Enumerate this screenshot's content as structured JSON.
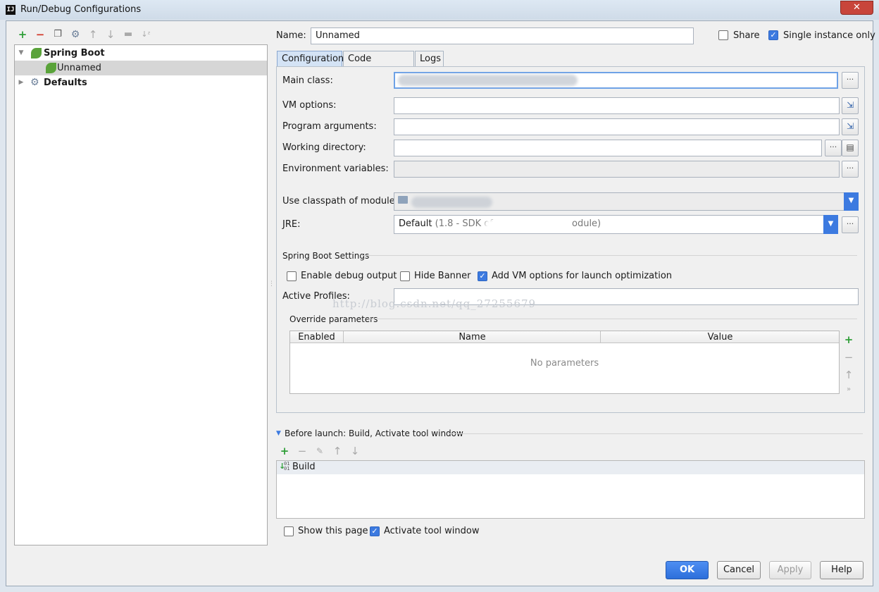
{
  "window": {
    "title": "Run/Debug Configurations",
    "app_icon_text": "IJ"
  },
  "tree": {
    "items": [
      {
        "label": "Spring Boot",
        "bold": true
      },
      {
        "label": "Unnamed",
        "bold": false
      },
      {
        "label": "Defaults",
        "bold": true
      }
    ]
  },
  "form": {
    "name_label": "Name:",
    "name_value": "Unnamed",
    "share_label": "Share",
    "single_instance_label": "Single instance only",
    "tabs": [
      "Configuration",
      "Code Coverage",
      "Logs"
    ],
    "main_class_label": "Main class:",
    "vm_options_label": "VM options:",
    "program_args_label": "Program arguments:",
    "working_dir_label": "Working directory:",
    "env_vars_label": "Environment variables:",
    "classpath_label": "Use classpath of module:",
    "jre_label": "JRE:",
    "jre_value_prefix": "Default",
    "jre_value_detail": "(1.8 - SDK of",
    "jre_value_suffix": "odule)",
    "spring_settings_label": "Spring Boot Settings",
    "enable_debug_label": "Enable debug output",
    "hide_banner_label": "Hide Banner",
    "add_vm_label": "Add VM options for launch optimization",
    "active_profiles_label": "Active Profiles:",
    "watermark": "http://blog.csdn.net/qq_27255679",
    "override_label": "Override parameters",
    "table_headers": [
      "Enabled",
      "Name",
      "Value"
    ],
    "table_empty": "No parameters",
    "before_launch_label": "Before launch: Build, Activate tool window",
    "before_launch_items": [
      "Build"
    ],
    "show_page_label": "Show this page",
    "activate_tool_label": "Activate tool window"
  },
  "checkbox_states": {
    "share": false,
    "single_instance": true,
    "enable_debug": false,
    "hide_banner": false,
    "add_vm": true,
    "show_page": false,
    "activate_tool": true
  },
  "buttons": {
    "ok": "OK",
    "cancel": "Cancel",
    "apply": "Apply",
    "help": "Help"
  },
  "colors": {
    "accent": "#3c7ae0",
    "add_green": "#2e9e37",
    "remove_red": "#d2392b"
  },
  "icons": [
    "add-icon",
    "remove-icon",
    "copy-icon",
    "wrench-icon",
    "arrow-up-icon",
    "arrow-down-icon",
    "folder-icon",
    "sort-icon",
    "spring-leaf-icon",
    "expand-icon"
  ]
}
